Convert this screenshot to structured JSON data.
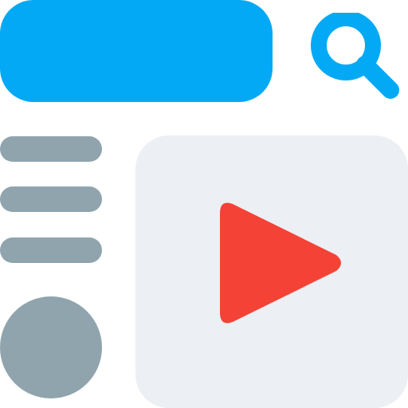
{
  "colors": {
    "accent_blue": "#03A9F4",
    "menu_gray": "#90A4AE",
    "panel_gray": "#ECEFF3",
    "play_red": "#F44336",
    "white": "#FFFFFF"
  },
  "icons": {
    "search": "search-icon",
    "play": "play-icon"
  },
  "menu": {
    "items": [
      {
        "kind": "line"
      },
      {
        "kind": "line"
      },
      {
        "kind": "line"
      }
    ]
  }
}
